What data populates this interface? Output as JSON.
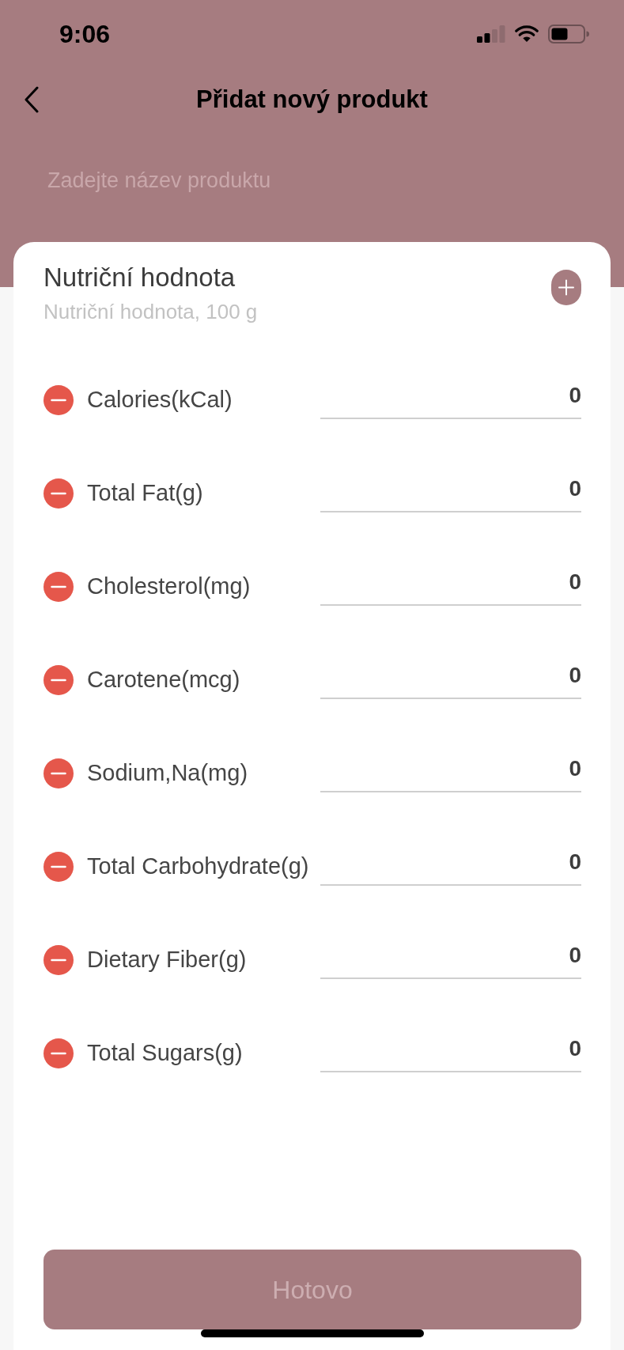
{
  "status_bar": {
    "time": "9:06"
  },
  "header": {
    "title": "Přidat nový produkt"
  },
  "name_field": {
    "placeholder": "Zadejte název produktu"
  },
  "nutrition": {
    "title": "Nutriční hodnota",
    "subtitle": "Nutriční hodnota, 100 g",
    "nutrients": [
      {
        "label": "Calories(kCal)",
        "value": "0"
      },
      {
        "label": "Total Fat(g)",
        "value": "0"
      },
      {
        "label": "Cholesterol(mg)",
        "value": "0"
      },
      {
        "label": "Carotene(mcg)",
        "value": "0"
      },
      {
        "label": "Sodium,Na(mg)",
        "value": "0"
      },
      {
        "label": "Total Carbohydrate(g)",
        "value": "0"
      },
      {
        "label": "Dietary Fiber(g)",
        "value": "0"
      },
      {
        "label": "Total Sugars(g)",
        "value": "0"
      }
    ]
  },
  "done_button": {
    "label": "Hotovo",
    "disabled": true
  }
}
